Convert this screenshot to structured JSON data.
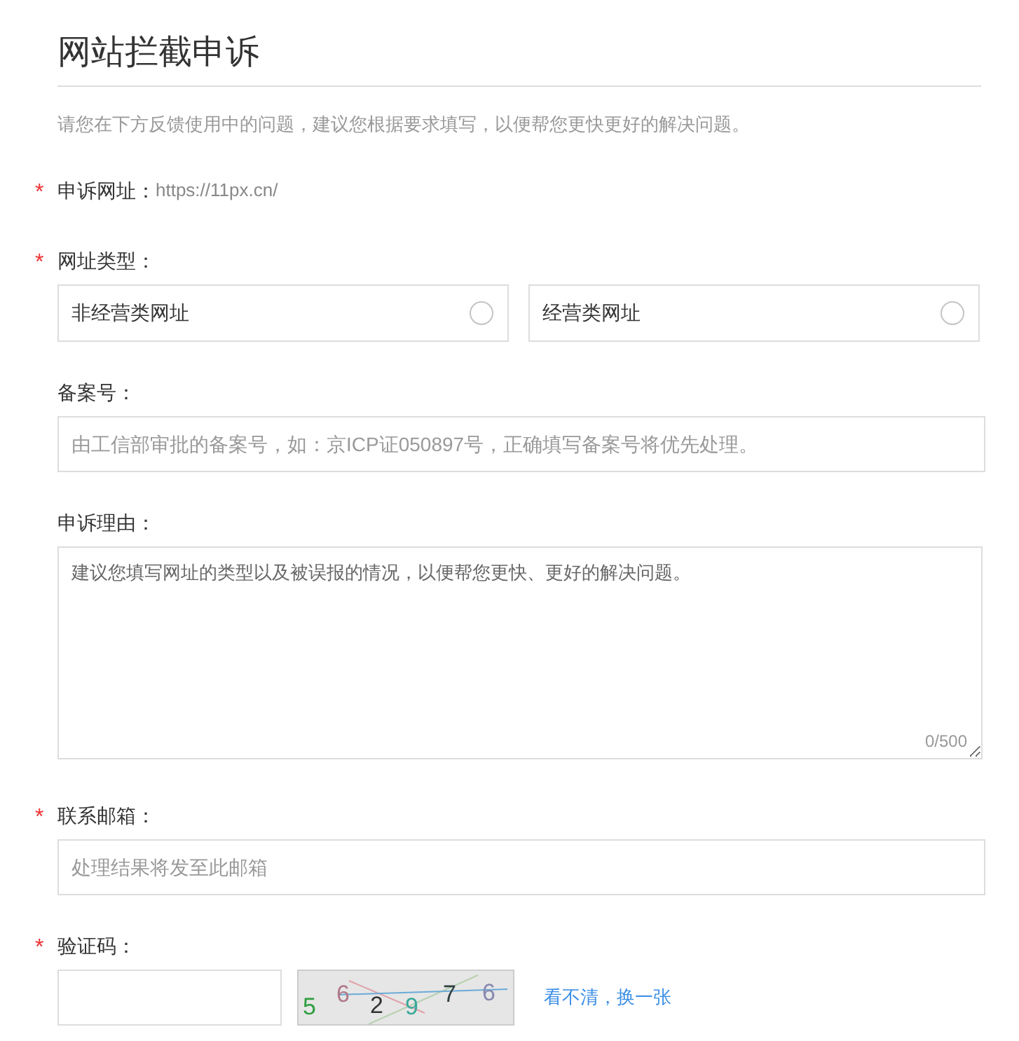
{
  "page": {
    "title": "网站拦截申诉",
    "description": "请您在下方反馈使用中的问题，建议您根据要求填写，以便帮您更快更好的解决问题。"
  },
  "fields": [
    {
      "kind": "static",
      "required_mark": "*",
      "label": "申诉网址：",
      "value": "https://11px.cn/"
    },
    {
      "kind": "radio",
      "required_mark": "*",
      "label": "网址类型：",
      "options": [
        {
          "label": "非经营类网址",
          "selected": false
        },
        {
          "label": "经营类网址",
          "selected": false
        }
      ]
    },
    {
      "kind": "input",
      "label": "备案号：",
      "placeholder": "由工信部审批的备案号，如：京ICP证050897号，正确填写备案号将优先处理。"
    },
    {
      "kind": "textarea",
      "label": "申诉理由：",
      "placeholder": "建议您填写网址的类型以及被误报的情况，以便帮您更快、更好的解决问题。",
      "counter": "0/500"
    },
    {
      "kind": "input",
      "required_mark": "*",
      "label": "联系邮箱：",
      "placeholder": "处理结果将发至此邮箱"
    },
    {
      "kind": "captcha",
      "required_mark": "*",
      "label": "验证码：",
      "captcha": [
        {
          "char": "5",
          "color": "#2e9e3e"
        },
        {
          "char": "6",
          "color": "#b07888"
        },
        {
          "char": "2",
          "color": "#333333"
        },
        {
          "char": "9",
          "color": "#3aa89a"
        },
        {
          "char": "7",
          "color": "#2f3f3f"
        },
        {
          "char": "6",
          "color": "#8888b0"
        }
      ],
      "refresh_link": "看不清，换一张"
    }
  ]
}
